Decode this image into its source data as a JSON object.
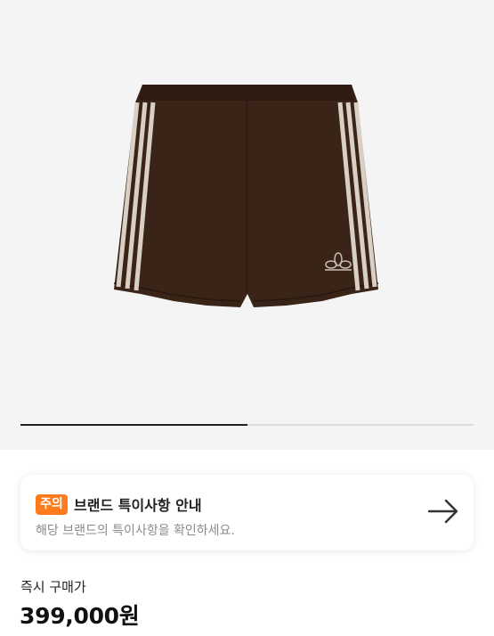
{
  "product": {
    "image_alt": "brown shorts",
    "gallery_progress": 0.5
  },
  "notice": {
    "badge": "주의",
    "badge_color": "#ff7a1a",
    "title": "브랜드 특이사항 안내",
    "description": "해당 브랜드의 특이사항을 확인하세요.",
    "arrow_icon": "arrow-right-icon"
  },
  "price": {
    "label": "즉시 구매가",
    "value": "399,000원"
  }
}
